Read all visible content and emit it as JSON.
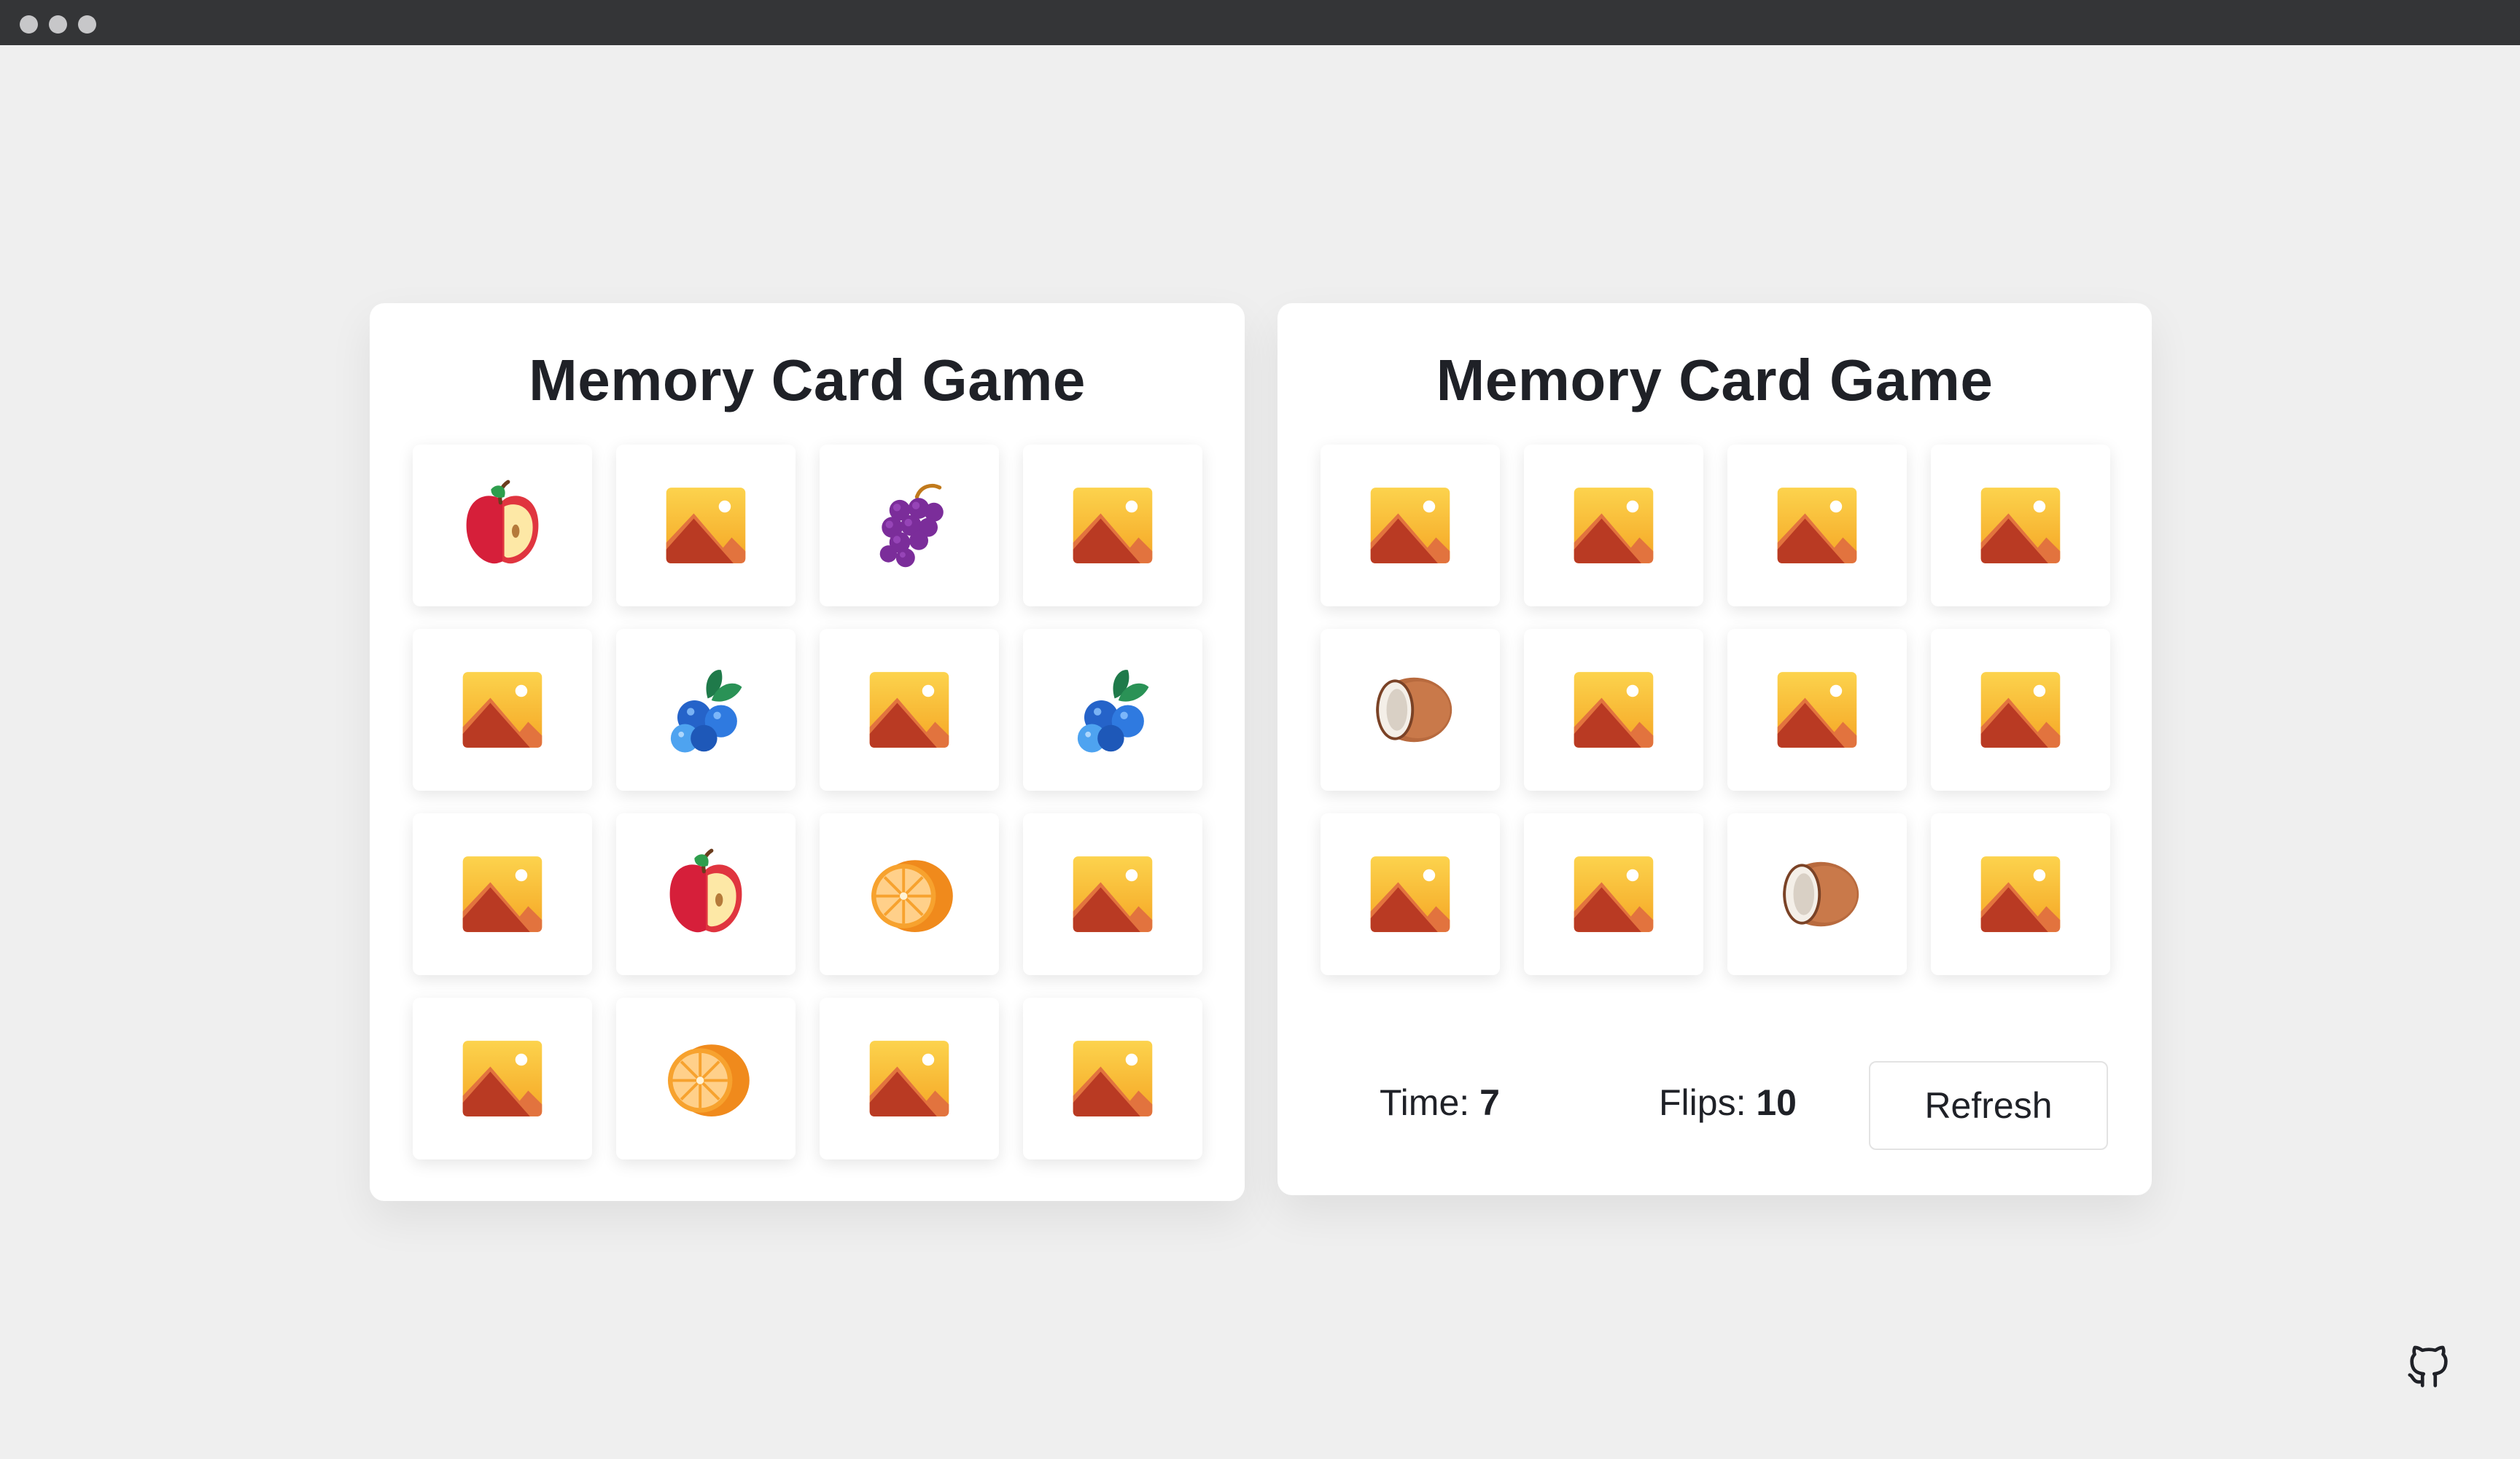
{
  "window": {
    "dots": [
      "close",
      "minimize",
      "maximize"
    ]
  },
  "boards": [
    {
      "title": "Memory Card Game",
      "columns": 4,
      "cards": [
        {
          "state": "flipped",
          "icon": "apple-icon"
        },
        {
          "state": "hidden",
          "icon": "image-placeholder-icon"
        },
        {
          "state": "flipped",
          "icon": "grapes-icon"
        },
        {
          "state": "hidden",
          "icon": "image-placeholder-icon"
        },
        {
          "state": "hidden",
          "icon": "image-placeholder-icon"
        },
        {
          "state": "flipped",
          "icon": "blueberries-icon"
        },
        {
          "state": "hidden",
          "icon": "image-placeholder-icon"
        },
        {
          "state": "flipped",
          "icon": "blueberries-icon"
        },
        {
          "state": "hidden",
          "icon": "image-placeholder-icon"
        },
        {
          "state": "flipped",
          "icon": "apple-icon"
        },
        {
          "state": "flipped",
          "icon": "orange-icon"
        },
        {
          "state": "hidden",
          "icon": "image-placeholder-icon"
        },
        {
          "state": "hidden",
          "icon": "image-placeholder-icon"
        },
        {
          "state": "flipped",
          "icon": "orange-icon"
        },
        {
          "state": "hidden",
          "icon": "image-placeholder-icon"
        },
        {
          "state": "hidden",
          "icon": "image-placeholder-icon"
        }
      ]
    },
    {
      "title": "Memory Card Game",
      "columns": 4,
      "cards": [
        {
          "state": "hidden",
          "icon": "image-placeholder-icon"
        },
        {
          "state": "hidden",
          "icon": "image-placeholder-icon"
        },
        {
          "state": "hidden",
          "icon": "image-placeholder-icon"
        },
        {
          "state": "hidden",
          "icon": "image-placeholder-icon"
        },
        {
          "state": "flipped",
          "icon": "coconut-icon"
        },
        {
          "state": "hidden",
          "icon": "image-placeholder-icon"
        },
        {
          "state": "hidden",
          "icon": "image-placeholder-icon"
        },
        {
          "state": "hidden",
          "icon": "image-placeholder-icon"
        },
        {
          "state": "hidden",
          "icon": "image-placeholder-icon"
        },
        {
          "state": "hidden",
          "icon": "image-placeholder-icon"
        },
        {
          "state": "flipped",
          "icon": "coconut-icon"
        },
        {
          "state": "hidden",
          "icon": "image-placeholder-icon"
        }
      ],
      "stats": {
        "time_label": "Time:",
        "time_value": "7",
        "flips_label": "Flips:",
        "flips_value": "10"
      },
      "refresh_label": "Refresh"
    }
  ],
  "footer": {
    "github_icon": "github-icon"
  },
  "colors": {
    "background": "#efefef",
    "titlebar": "#343537",
    "panel": "#ffffff",
    "text": "#1f2127"
  }
}
